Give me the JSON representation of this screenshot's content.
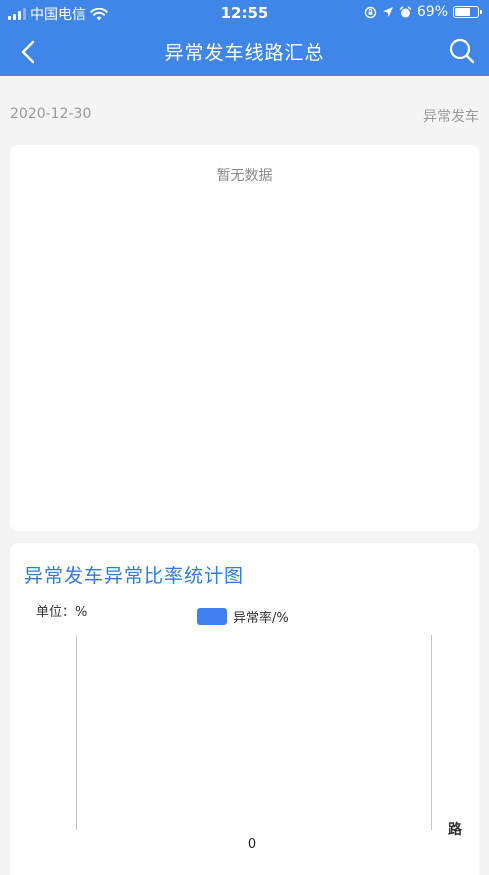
{
  "status_bar": {
    "carrier": "中国电信",
    "time": "12:55",
    "battery": "69%",
    "battery_level": 0.69
  },
  "header": {
    "title": "异常发车线路汇总",
    "back_icon": "chevron-left-icon",
    "search_icon": "search-icon"
  },
  "filter": {
    "date": "2020-12-30",
    "type": "异常发车"
  },
  "list_card": {
    "empty_text": "暂无数据"
  },
  "chart": {
    "title": "异常发车异常比率统计图",
    "unit": "单位：%",
    "legend": "异常率/%",
    "y_tick": "0",
    "x_label": "路"
  },
  "colors": {
    "header_bg": "#3f86e8",
    "accent": "#2f7be0",
    "series": "#3f7ff0",
    "page_bg": "#f4f4f4"
  },
  "chart_data": {
    "type": "bar",
    "title": "异常发车异常比率统计图",
    "ylabel": "单位：%",
    "xlabel": "路",
    "series": [
      {
        "name": "异常率/%",
        "values": []
      }
    ],
    "categories": [],
    "y_ticks": [
      "0"
    ],
    "legend_position": "top"
  }
}
